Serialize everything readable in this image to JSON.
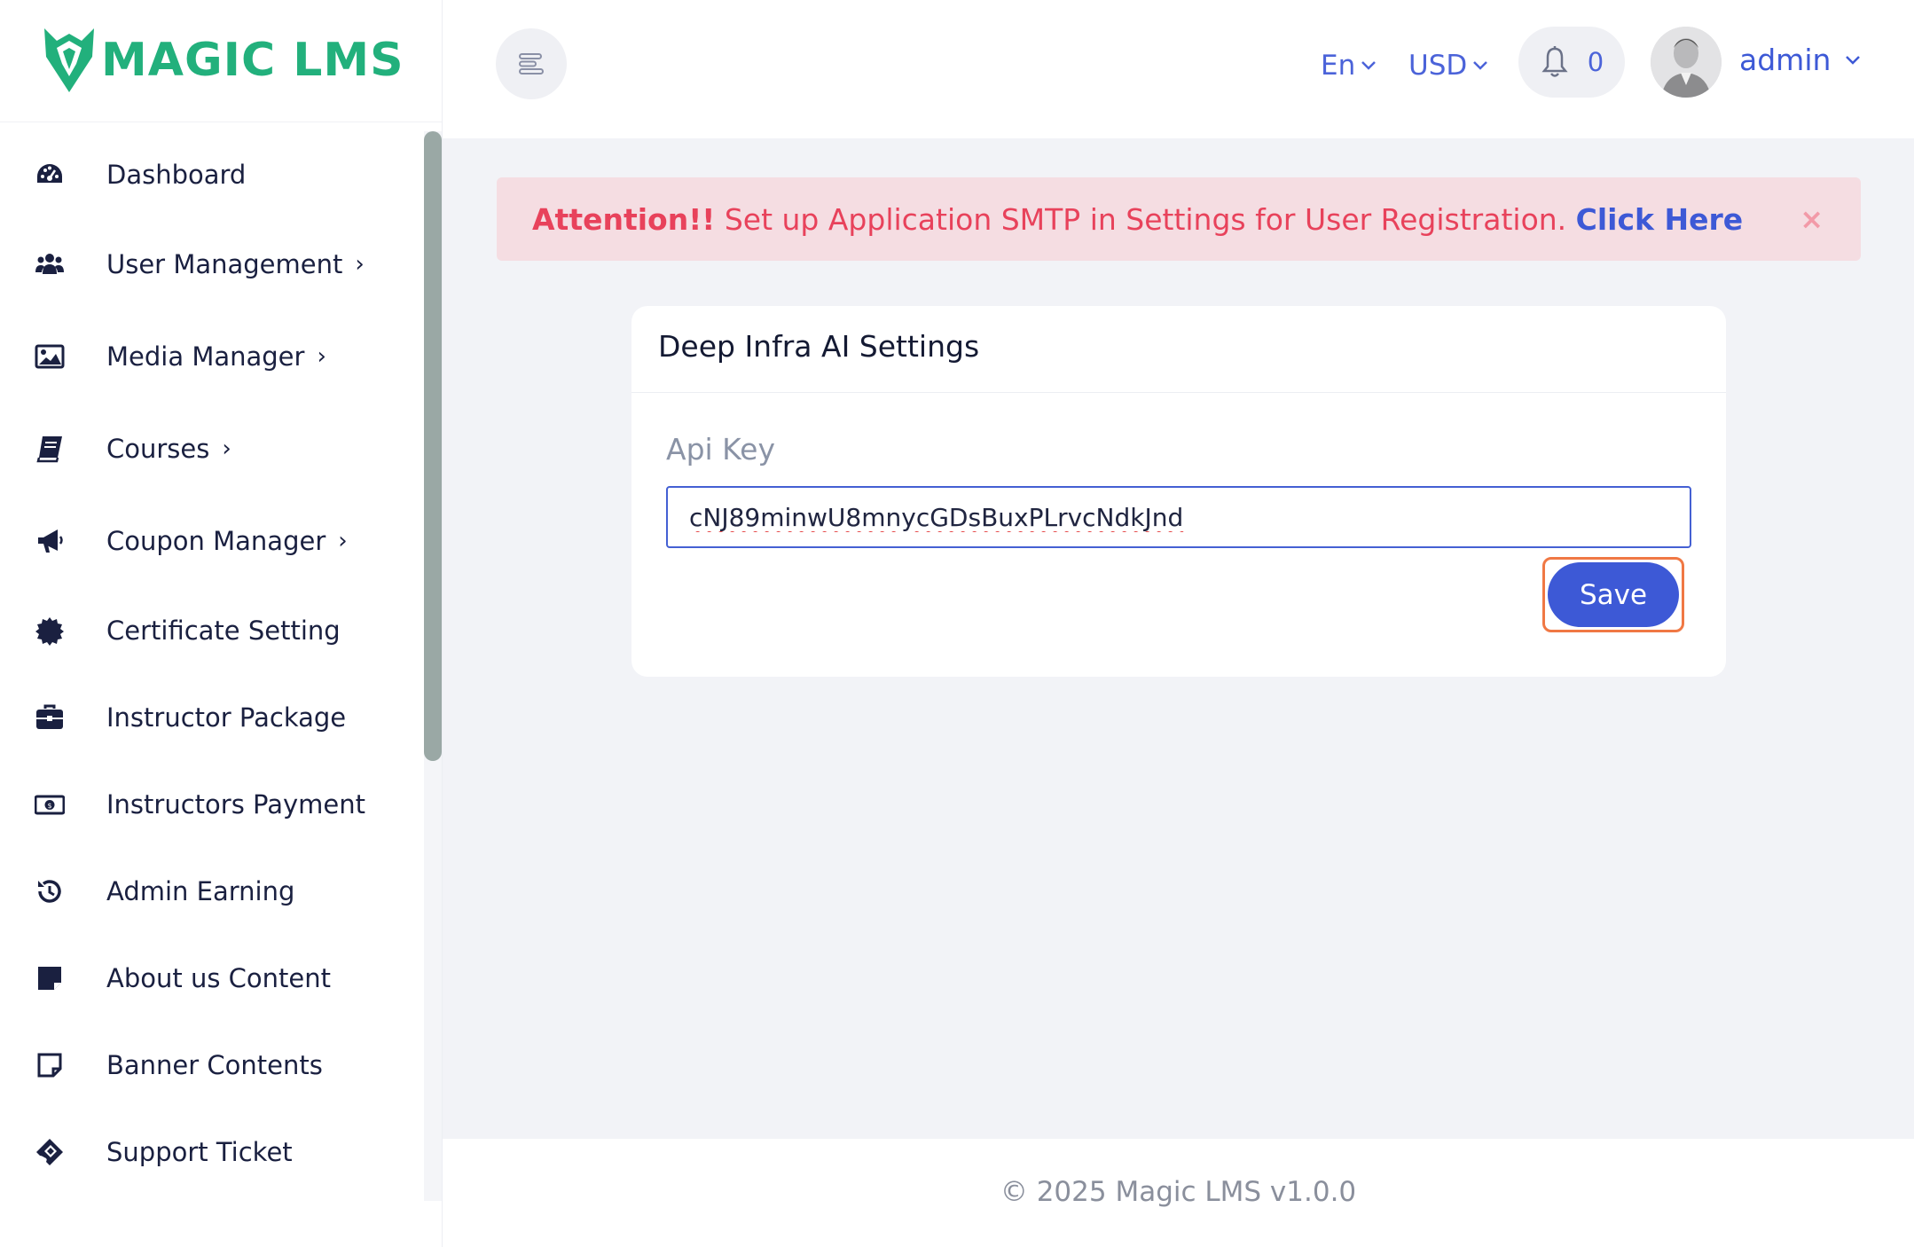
{
  "brand": {
    "name": "MAGIC LMS",
    "color": "#22b07c"
  },
  "sidebar": {
    "items": [
      {
        "label": "Dashboard",
        "icon": "gauge-icon",
        "has_submenu": false
      },
      {
        "label": "User Management",
        "icon": "users-icon",
        "has_submenu": true
      },
      {
        "label": "Media Manager",
        "icon": "image-icon",
        "has_submenu": true
      },
      {
        "label": "Courses",
        "icon": "book-icon",
        "has_submenu": true
      },
      {
        "label": "Coupon Manager",
        "icon": "megaphone-icon",
        "has_submenu": true
      },
      {
        "label": "Certificate Setting",
        "icon": "certificate-icon",
        "has_submenu": false
      },
      {
        "label": "Instructor Package",
        "icon": "briefcase-icon",
        "has_submenu": false
      },
      {
        "label": "Instructors Payment",
        "icon": "money-bill-icon",
        "has_submenu": false
      },
      {
        "label": "Admin Earning",
        "icon": "history-icon",
        "has_submenu": false
      },
      {
        "label": "About us Content",
        "icon": "sticky-note-solid-icon",
        "has_submenu": false
      },
      {
        "label": "Banner Contents",
        "icon": "sticky-note-outline-icon",
        "has_submenu": false
      },
      {
        "label": "Support Ticket",
        "icon": "ticket-icon",
        "has_submenu": false
      }
    ]
  },
  "header": {
    "language": "En",
    "currency": "USD",
    "notification_count": "0",
    "user": "admin"
  },
  "alert": {
    "prefix": "Attention!!",
    "message": " Set up Application SMTP in Settings for User Registration. ",
    "link": "Click Here",
    "close": "×"
  },
  "card": {
    "title": "Deep Infra AI Settings",
    "field_label": "Api Key",
    "api_key": "cNJ89minwU8mnycGDsBuxPLrvcNdkJnd",
    "save_label": "Save"
  },
  "footer": {
    "text": "© 2025 Magic LMS v1.0.0"
  },
  "colors": {
    "accent": "#3d59d6",
    "alert_text": "#e8425b",
    "alert_bg": "#f5dde2",
    "highlight": "#f07844"
  }
}
